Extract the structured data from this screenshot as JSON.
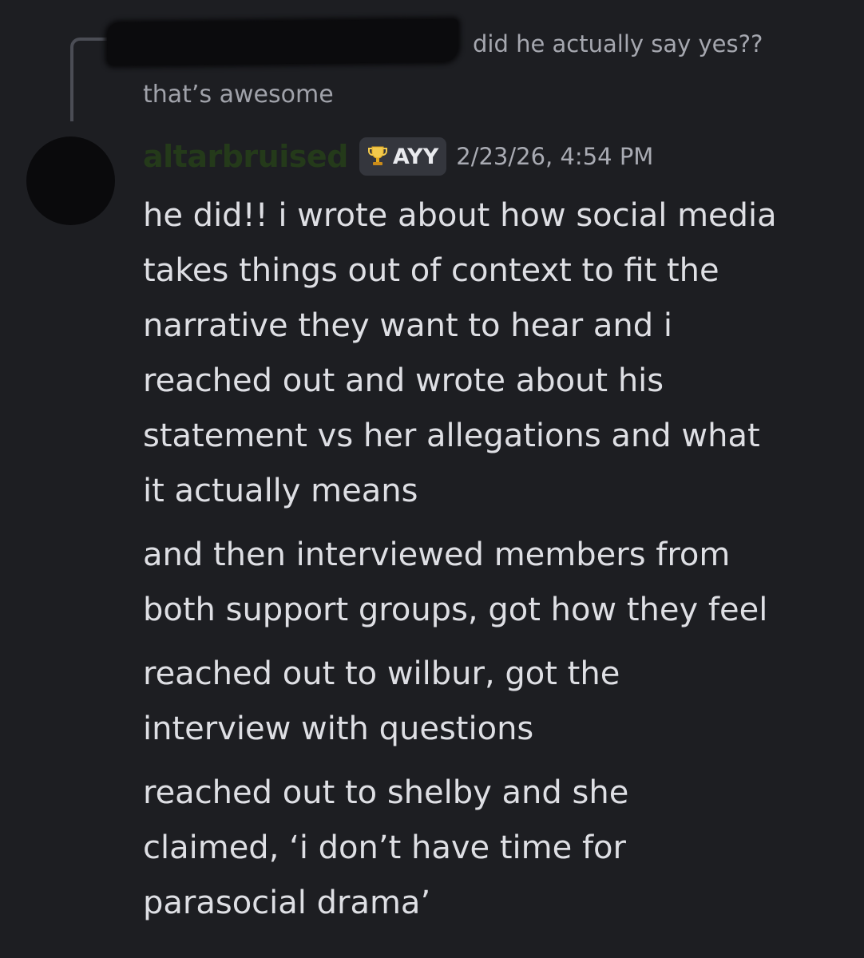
{
  "reply": {
    "preview_text": "did he actually say yes??"
  },
  "previous_message": {
    "text": "that’s awesome"
  },
  "message": {
    "username": "altarbruised",
    "role_badge": {
      "icon": "trophy-icon",
      "label": "AYY"
    },
    "timestamp": "2/23/26, 4:54 PM",
    "paragraphs": [
      "he did!! i wrote about how social media\ntakes things out of context to fit the\nnarrative they want to hear and i\nreached out and wrote about his\nstatement vs her allegations and what\nit actually means",
      "and then interviewed members from\nboth support groups, got how they feel",
      "reached out to wilbur, got the\ninterview with questions",
      "reached out to shelby and she\nclaimed, ‘i don’t have time for\nparasocial drama’"
    ]
  },
  "colors": {
    "background": "#1d1e22",
    "username": "#243a1a",
    "badge_background": "#34363d",
    "text_primary": "#dedfe4",
    "text_muted": "#a0a2aa"
  }
}
